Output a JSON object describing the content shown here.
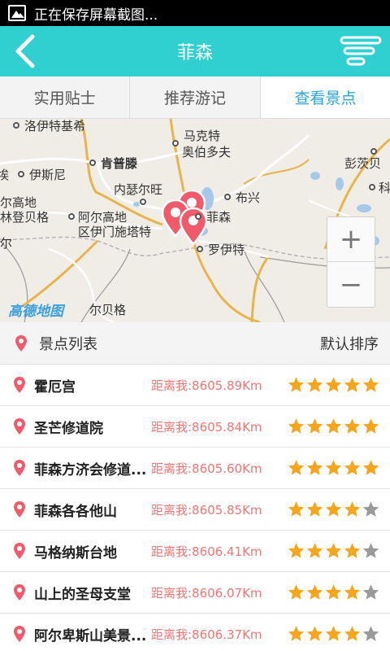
{
  "status": {
    "text": "正在保存屏幕截图..."
  },
  "header": {
    "title": "菲森"
  },
  "tabs": [
    {
      "label": "实用贴士",
      "active": false
    },
    {
      "label": "推荐游记",
      "active": false
    },
    {
      "label": "查看景点",
      "active": true
    }
  ],
  "map": {
    "labels": {
      "l1": "洛伊特基希",
      "l2": "马克特",
      "l3": "奥伯多夫",
      "l4": "伊斯尼",
      "l5": "肯普滕",
      "l6": "彭茨贝",
      "l7": "内瑟尔旺",
      "l8": "布兴",
      "l9": "尔高地",
      "l10": "林登贝格",
      "l11": "阿尔高地",
      "l12": "区伊门施塔特",
      "l13": "菲森",
      "l14": "科",
      "l15": "罗伊特",
      "l16": "埃",
      "l17": "尔贝格",
      "l18": "尔"
    },
    "logo": "高德地图",
    "zoom_in": "+",
    "zoom_out": "−"
  },
  "list_header": {
    "title": "景点列表",
    "sort": "默认排序"
  },
  "attractions": [
    {
      "name": "霍厄宫",
      "distance": "距离我:8605.89Km",
      "rating": 5
    },
    {
      "name": "圣芒修道院",
      "distance": "距离我:8605.84Km",
      "rating": 5
    },
    {
      "name": "菲森方济会修道...",
      "distance": "距离我:8605.60Km",
      "rating": 5
    },
    {
      "name": "菲森各各他山",
      "distance": "距离我:8605.85Km",
      "rating": 4
    },
    {
      "name": "马格纳斯台地",
      "distance": "距离我:8606.41Km",
      "rating": 4
    },
    {
      "name": "山上的圣母支堂",
      "distance": "距离我:8606.07Km",
      "rating": 4
    },
    {
      "name": "阿尔卑斯山美景...",
      "distance": "距离我:8606.37Km",
      "rating": 4
    }
  ],
  "colors": {
    "accent": "#2fd0cf",
    "active_tab": "#2aa7d6",
    "distance": "#f37575",
    "star_on": "#f7a51c",
    "star_off": "#9a9a9a",
    "pin": "#f05a6a"
  }
}
